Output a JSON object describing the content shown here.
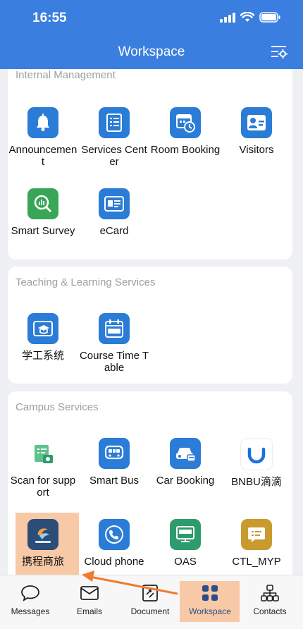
{
  "status": {
    "time": "16:55"
  },
  "header": {
    "title": "Workspace"
  },
  "sections": {
    "internal": {
      "title": "Internal Management",
      "apps": [
        {
          "label": "Announcement",
          "icon": "bell-icon"
        },
        {
          "label": "Services Center",
          "icon": "checklist-icon"
        },
        {
          "label": "Room Booking",
          "icon": "calendar-clock-icon"
        },
        {
          "label": "Visitors",
          "icon": "visitor-card-icon"
        },
        {
          "label": "Smart Survey",
          "icon": "survey-chart-icon"
        },
        {
          "label": "eCard",
          "icon": "id-card-icon"
        }
      ]
    },
    "teaching": {
      "title": "Teaching & Learning Services",
      "apps": [
        {
          "label": "学工系统",
          "icon": "graduation-cap-icon"
        },
        {
          "label": "Course Time Table",
          "icon": "course-calendar-icon"
        }
      ]
    },
    "campus": {
      "title": "Campus Services",
      "apps": [
        {
          "label": "Scan for support",
          "icon": "scan-support-icon"
        },
        {
          "label": "Smart Bus",
          "icon": "bus-icon"
        },
        {
          "label": "Car Booking",
          "icon": "car-icon"
        },
        {
          "label": "BNBU滴滴",
          "icon": "didi-icon"
        },
        {
          "label": "携程商旅",
          "icon": "ctrip-icon"
        },
        {
          "label": "Cloud phone",
          "icon": "phone-icon"
        },
        {
          "label": "OAS",
          "icon": "www-monitor-icon"
        },
        {
          "label": "CTL_MYP",
          "icon": "chat-list-icon"
        }
      ]
    }
  },
  "tabs": [
    {
      "label": "Messages",
      "icon": "message-bubble-icon"
    },
    {
      "label": "Emails",
      "icon": "envelope-icon"
    },
    {
      "label": "Document",
      "icon": "document-share-icon"
    },
    {
      "label": "Workspace",
      "icon": "grid-icon",
      "active": true
    },
    {
      "label": "Contacts",
      "icon": "org-chart-icon"
    }
  ],
  "colors": {
    "header": "#3a7ee0",
    "highlight": "#f8c9a6",
    "arrow": "#f07a30",
    "active_tab": "#2a4f8a"
  }
}
